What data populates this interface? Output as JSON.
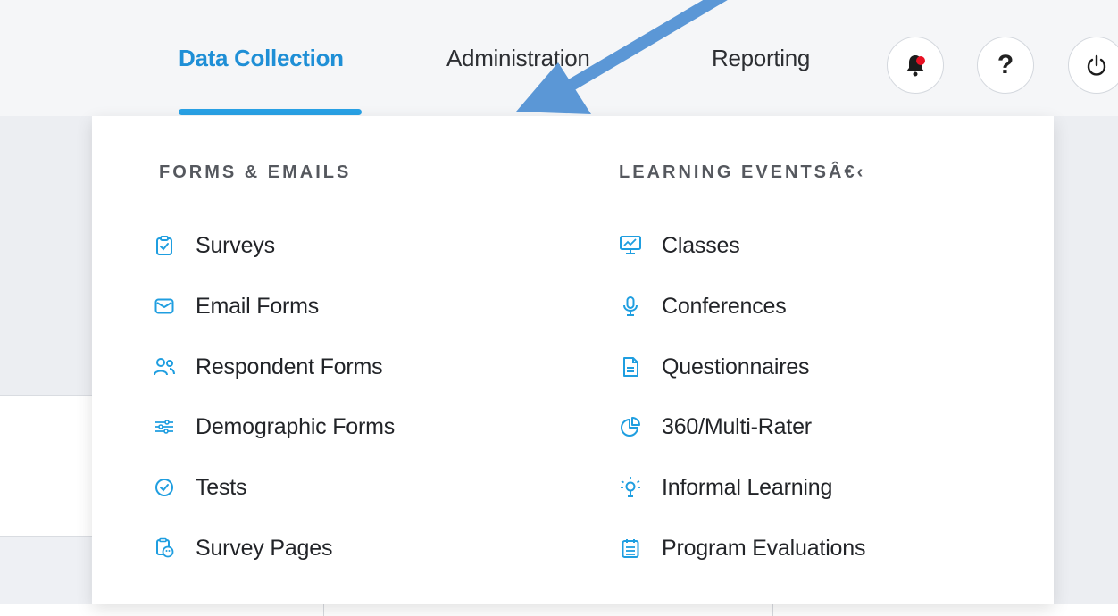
{
  "nav": {
    "tabs": [
      {
        "label": "Data Collection",
        "active": true
      },
      {
        "label": "Administration",
        "active": false
      },
      {
        "label": "Reporting",
        "active": false
      }
    ],
    "help_label": "?",
    "notification_badge_color": "#e81123",
    "accent_color": "#29a2e6"
  },
  "dropdown": {
    "sections": [
      {
        "heading": "FORMS & EMAILS",
        "items": [
          {
            "label": "Surveys",
            "icon": "clipboard-check-icon"
          },
          {
            "label": "Email Forms",
            "icon": "envelope-icon"
          },
          {
            "label": "Respondent Forms",
            "icon": "people-icon"
          },
          {
            "label": "Demographic Forms",
            "icon": "sliders-icon"
          },
          {
            "label": "Tests",
            "icon": "check-circle-icon"
          },
          {
            "label": "Survey Pages",
            "icon": "pages-palette-icon"
          }
        ]
      },
      {
        "heading": "LEARNING EVENTSÂ€‹",
        "items": [
          {
            "label": "Classes",
            "icon": "presentation-chart-icon"
          },
          {
            "label": "Conferences",
            "icon": "microphone-icon"
          },
          {
            "label": "Questionnaires",
            "icon": "document-icon"
          },
          {
            "label": "360/Multi-Rater",
            "icon": "pie-chart-icon"
          },
          {
            "label": "Informal Learning",
            "icon": "lightbulb-icon"
          },
          {
            "label": "Program Evaluations",
            "icon": "calendar-list-icon"
          }
        ]
      }
    ]
  },
  "annotation": {
    "arrow_color": "#5b97d6"
  }
}
